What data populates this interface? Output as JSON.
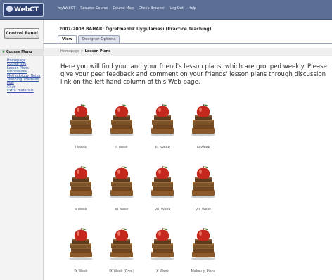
{
  "app": {
    "logo_text": "WebCT",
    "topnav": [
      "myWebCT",
      "Resume Course",
      "Course Map",
      "Check Browser",
      "Log Out",
      "Help"
    ]
  },
  "left": {
    "control_panel_label": "Control Panel",
    "course_menu_label": "Course Menu",
    "menu_items": [
      "Homepage",
      "Course Info",
      "Lesson Plans",
      "Discussions",
      "Methodology_Notes",
      "Teaching_Practices",
      "Mail",
      "Chat",
      "Extra_materials"
    ]
  },
  "header": {
    "course_title": "2007-2008 BAHAR: Öğretmenlik Uygulaması (Practice Teaching)",
    "tabs": [
      "View",
      "Designer Options"
    ]
  },
  "breadcrumb": {
    "home": "Homepage",
    "separator": ">",
    "current": "Lesson Plans"
  },
  "main": {
    "intro_text": "Here you will find your and your friend's lesson plans, which are grouped weekly. Please give your peer feedback and comment on your friends' lesson plans through discussion link on the left hand column of this Web page.",
    "folders": [
      "I.Week",
      "II.Week",
      "III. Week",
      "IV.Week",
      "V.Week",
      "VI.Week",
      "VII. Week",
      "VIII.Week",
      "IX Week",
      "IX Week (Con.)",
      "X.Week",
      "Make-up Plans"
    ]
  },
  "colors": {
    "topbar": "#5b6f95",
    "link": "#3355aa",
    "apple": "#c4281c",
    "book": "#8a5a2b"
  }
}
